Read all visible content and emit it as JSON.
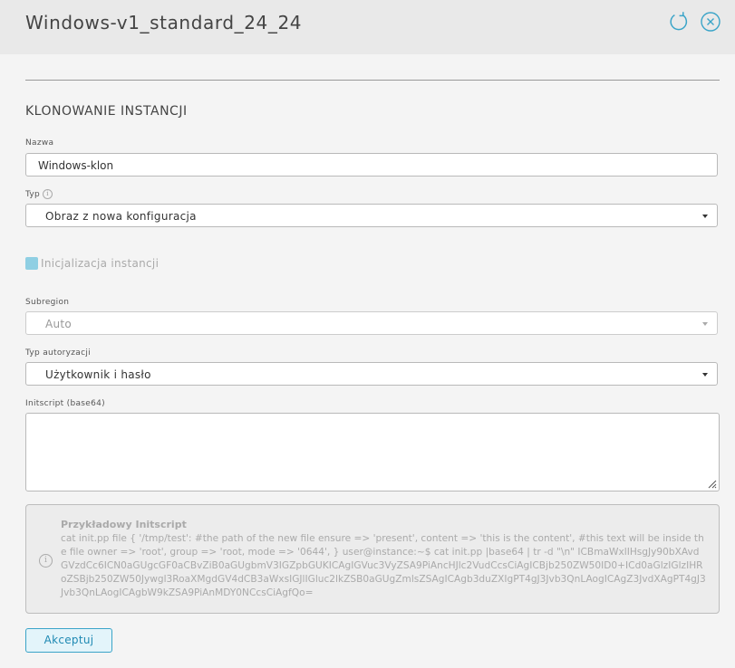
{
  "header": {
    "title": "Windows-v1_standard_24_24",
    "icons": [
      "refresh-icon",
      "close-icon"
    ],
    "accent": "#3aa4c8"
  },
  "section_title": "KLONOWANIE INSTANCJI",
  "fields": {
    "name": {
      "label": "Nazwa",
      "value": "Windows-klon"
    },
    "type": {
      "label": "Typ",
      "value": "Obraz z nowa konfiguracja"
    },
    "init": {
      "label": "Inicjalizacja instancji"
    },
    "subregion": {
      "label": "Subregion",
      "value": "Auto"
    },
    "auth": {
      "label": "Typ autoryzacji",
      "value": "Użytkownik i hasło"
    },
    "initscript": {
      "label": "Initscript (base64)",
      "value": ""
    }
  },
  "example": {
    "title": "Przykładowy Initscript",
    "text": "cat init.pp file { '/tmp/test': #the path of the new file ensure => 'present', content => 'this is the content', #this text will be inside the file owner => 'root', group => 'root, mode => '0644', } user@instance:~$ cat init.pp |base64 | tr -d \"\\n\" ICBmaWxlIHsgJy90bXAvdGVzdCc6ICN0aGUgcGF0aCBvZiB0aGUgbmV3IGZpbGUKICAgIGVuc3VyZSA9PiAncHJlc2VudCcsCiAgICBjb250ZW50ID0+ICd0aGlzIGlzIHRoZSBjb250ZW50Jywgl3RoaXMgdGV4dCB3aWxsIGJlIGluc2lkZSB0aGUgZmlsZSAgICAgb3duZXIgPT4gJ3Jvb3QnLAogICAgZ3JvdXAgPT4gJ3Jvb3QnLAogICAgbW9kZSA9PiAnMDY0NCcsCiAgfQo="
  },
  "buttons": {
    "accept": "Akceptuj"
  }
}
